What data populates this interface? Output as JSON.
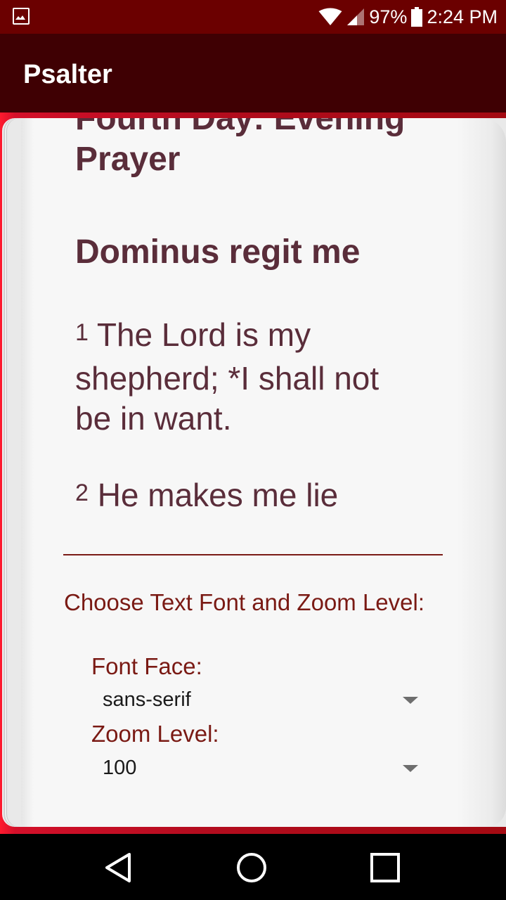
{
  "status_bar": {
    "battery_percent": "97%",
    "time": "2:24 PM",
    "icons": [
      "image-notification-icon",
      "wifi-icon",
      "cell-signal-icon",
      "battery-icon"
    ]
  },
  "app_bar": {
    "title": "Psalter"
  },
  "reader": {
    "day_title": "Fourth Day: Evening Prayer",
    "psalm_title": "Dominus regit me",
    "verses": [
      {
        "number": "1",
        "text": " The Lord is my shepherd; *I shall not be in want."
      },
      {
        "number": "2",
        "text": " He makes me lie down in green pastures"
      }
    ]
  },
  "settings": {
    "heading": "Choose Text Font and Zoom Level:",
    "font_face_label": "Font Face:",
    "font_face_value": "sans-serif",
    "zoom_label": "Zoom Level:",
    "zoom_value": "100"
  },
  "navigation": {
    "icons": [
      "back-icon",
      "home-icon",
      "recents-icon"
    ]
  },
  "colors": {
    "status_bar": "#6b0000",
    "app_bar": "#3f0003",
    "reader_text": "#5a2d3a",
    "settings_text": "#7a1a14",
    "book_cover": "#b30c1e"
  }
}
